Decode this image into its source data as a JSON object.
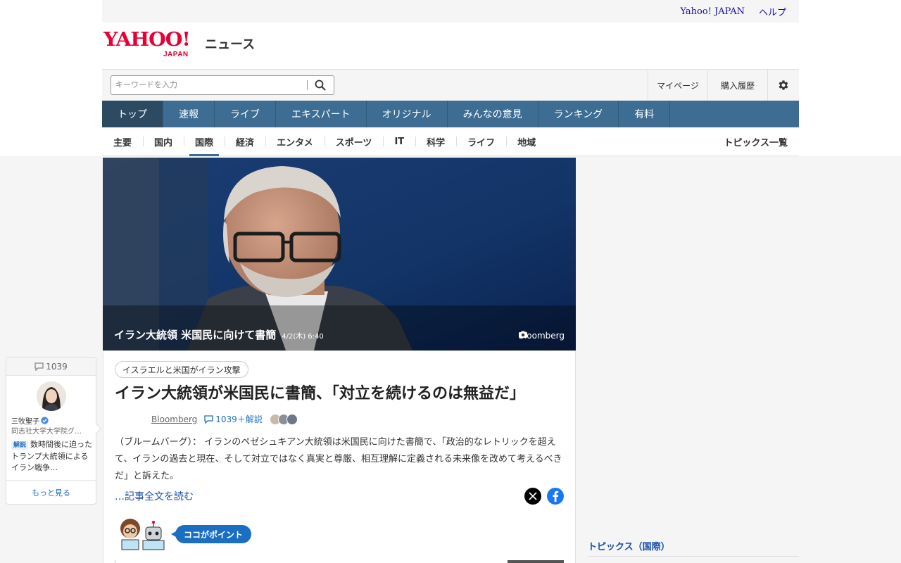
{
  "util": {
    "yahoo_japan": "Yahoo! JAPAN",
    "help": "ヘルプ"
  },
  "logo": {
    "brand": "YAHOO!",
    "sub": "JAPAN",
    "service": "ニュース"
  },
  "search": {
    "placeholder": "キーワードを入力"
  },
  "account": {
    "mypage": "マイページ",
    "history": "購入履歴"
  },
  "mainnav": [
    "トップ",
    "速報",
    "ライブ",
    "エキスパート",
    "オリジナル",
    "みんなの意見",
    "ランキング",
    "有料"
  ],
  "subnav": [
    "主要",
    "国内",
    "国際",
    "経済",
    "エンタメ",
    "スポーツ",
    "IT",
    "科学",
    "ライフ",
    "地域"
  ],
  "subnav_topics": "トピックス一覧",
  "hero": {
    "title": "イラン大統領 米国民に向けて書簡",
    "date": "4/2(木) 6:40",
    "credit": "Bloomberg"
  },
  "article": {
    "tag": "イスラエルと米国がイラン攻撃",
    "headline": "イラン大統領が米国民に書簡、「対立を続けるのは無益だ」",
    "source": "Bloomberg",
    "comments": "1039＋解説",
    "summary": "（ブルームバーグ）： イランのペゼシュキアン大統領は米国民に向けた書簡で、「政治的なレトリックを超えて、イランの過去と現在、そして対立ではなく真実と尊厳、相互理解に定義される未来像を改めて考えるべきだ」と訴えた。",
    "read_more": "…記事全文を読む",
    "point_label": "ココがポイント"
  },
  "comment_widget": {
    "count": "1039",
    "name": "三牧聖子",
    "affiliation": "同志社大学大学院グ…",
    "badge": "解説",
    "text": "数時間後に迫ったトランプ大統領によるイラン戦争…",
    "more": "もっと見る"
  },
  "right": {
    "topics_heading": "トピックス（国際）"
  },
  "colors": {
    "nav": "#3d6d92",
    "nav_active": "#2c4a62",
    "brand_red": "#e60033",
    "link": "#1a4fa8"
  }
}
